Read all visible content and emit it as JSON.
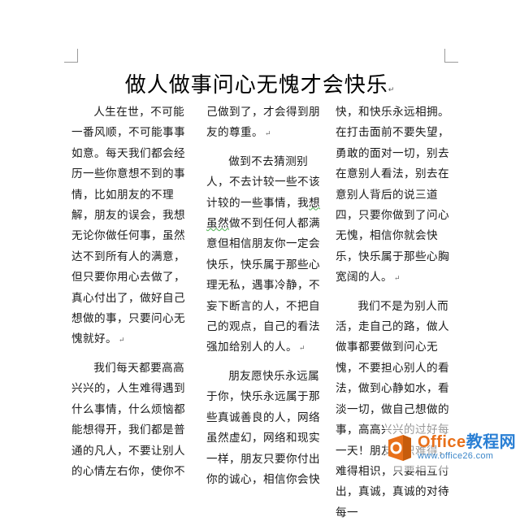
{
  "document": {
    "title": "做人做事问心无愧才会快乐",
    "paragraph_mark": "↵"
  },
  "columns": {
    "col1": {
      "p1": "人生在世，不可能一番风顺，不可能事事如意。每天我们都会经历一些你意想不到的事情，比如朋友的不理解，朋友的误会，我想无论你做任何事，虽然达不到所有人的满意，但只要你用心去做了，真心付出了，做好自己想做的事，只要问心无愧就好。",
      "p2": "我们每天都要高高兴兴的，人生难得遇到什么事情，什么烦恼都能想得开，我们都是普通的凡人，不要让别人的心情左右你，使你不"
    },
    "col2": {
      "p1": "己做到了，才会得到朋友的尊重。",
      "p2a": "做到不去猜测别人，不去计较一些不该计较的一些事情，我",
      "p2_spell": "想虽然",
      "p2b": "做不到任何人都满意但相信朋友你一定会快乐，快乐属于那些心理无私，遇事冷静，不妄下断言的人，不把自己的观点，自己的看法强加给别人的人。",
      "p3": "朋友愿快乐永远属于你，快乐永远属于那些真诚善良的人，网络虽然虚幻，网络和现实一样，朋友只要你付出你的诚心，相信你会快"
    },
    "col3": {
      "p1": "快，和快乐永远相拥。在打击面前不要失望，勇敢的面对一切，别去在意别人看法，别去在意别人背后的说三道四，只要你做到了问心无愧，相信你就会快乐，快乐属于那些心胸宽阔的人。",
      "p2": "我们不是为别人而活，走自己的路，做人做事都要做到问心无愧，不要担心别人的看法，做到心静如水，看淡一切，做自己想做的事，高高兴兴的过好每一天！朋友相识难得，难得相识，只要相互付出，真诚，真诚的对待每一"
    }
  },
  "watermark": {
    "brand_prefix": "Office",
    "brand_suffix": "教程网",
    "url": "www.office26.com",
    "brand_color": "#e8701a",
    "accent_color": "#2a7fd4"
  }
}
